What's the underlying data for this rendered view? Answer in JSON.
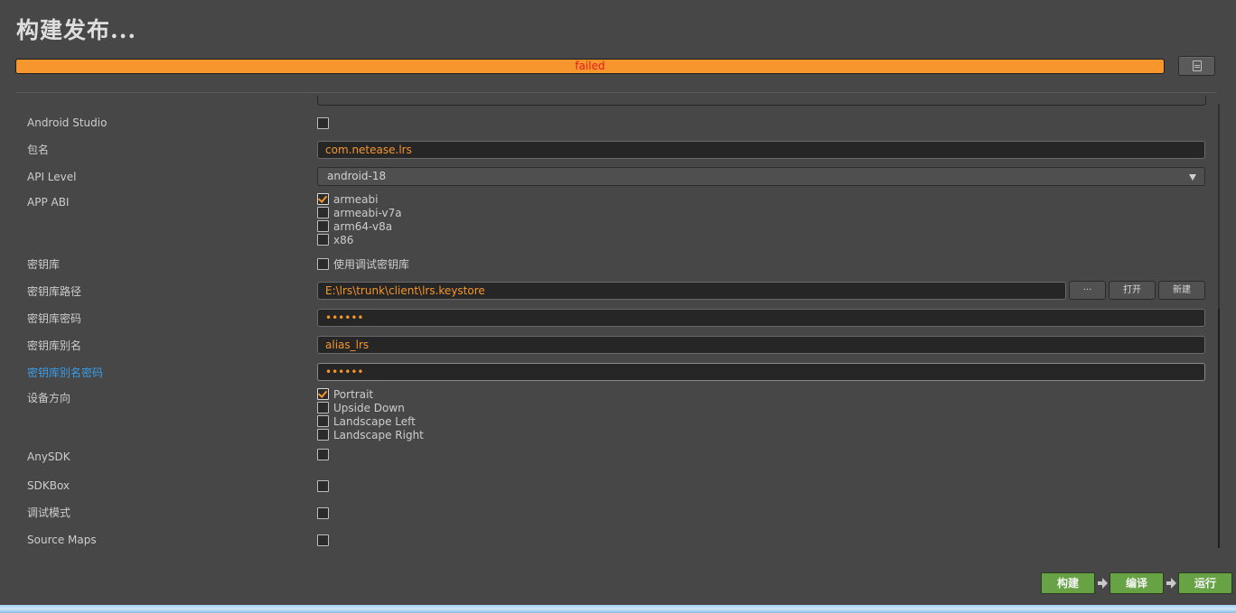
{
  "window": {
    "title": "构建发布...",
    "progress": {
      "status_text": "failed",
      "percent": 100
    }
  },
  "colors": {
    "accent": "#f6962c",
    "error_text": "#e52020",
    "link_label": "#3a9ee8",
    "action_button": "#67a345"
  },
  "icons": {
    "log_button": "document-icon",
    "dropdown": "chevron-down-icon",
    "step_arrow": "arrow-right-icon"
  },
  "form": {
    "android_studio": {
      "label": "Android Studio",
      "checked": false
    },
    "package_name": {
      "label": "包名",
      "value": "com.netease.lrs"
    },
    "api_level": {
      "label": "API Level",
      "selected": "android-18"
    },
    "app_abi": {
      "label": "APP ABI",
      "options": [
        {
          "label": "armeabi",
          "checked": true
        },
        {
          "label": "armeabi-v7a",
          "checked": false
        },
        {
          "label": "arm64-v8a",
          "checked": false
        },
        {
          "label": "x86",
          "checked": false
        }
      ]
    },
    "keystore": {
      "label": "密钥库",
      "option_label": "使用调试密钥库",
      "checked": false
    },
    "keystore_path": {
      "label": "密钥库路径",
      "value": "E:\\lrs\\trunk\\client\\lrs.keystore",
      "browse_label": "···",
      "open_label": "打开",
      "new_label": "新建"
    },
    "keystore_password": {
      "label": "密钥库密码",
      "value": "••••••"
    },
    "keystore_alias": {
      "label": "密钥库别名",
      "value": "alias_lrs"
    },
    "alias_password": {
      "label": "密钥库别名密码",
      "value": "••••••"
    },
    "orientation": {
      "label": "设备方向",
      "options": [
        {
          "label": "Portrait",
          "checked": true
        },
        {
          "label": "Upside Down",
          "checked": false
        },
        {
          "label": "Landscape Left",
          "checked": false
        },
        {
          "label": "Landscape Right",
          "checked": false
        }
      ]
    },
    "anysdk": {
      "label": "AnySDK",
      "checked": false
    },
    "sdkbox": {
      "label": "SDKBox",
      "checked": false
    },
    "debug_mode": {
      "label": "调试模式",
      "checked": false
    },
    "source_maps": {
      "label": "Source Maps",
      "checked": false
    }
  },
  "actions": {
    "build": "构建",
    "compile": "编译",
    "run": "运行"
  }
}
